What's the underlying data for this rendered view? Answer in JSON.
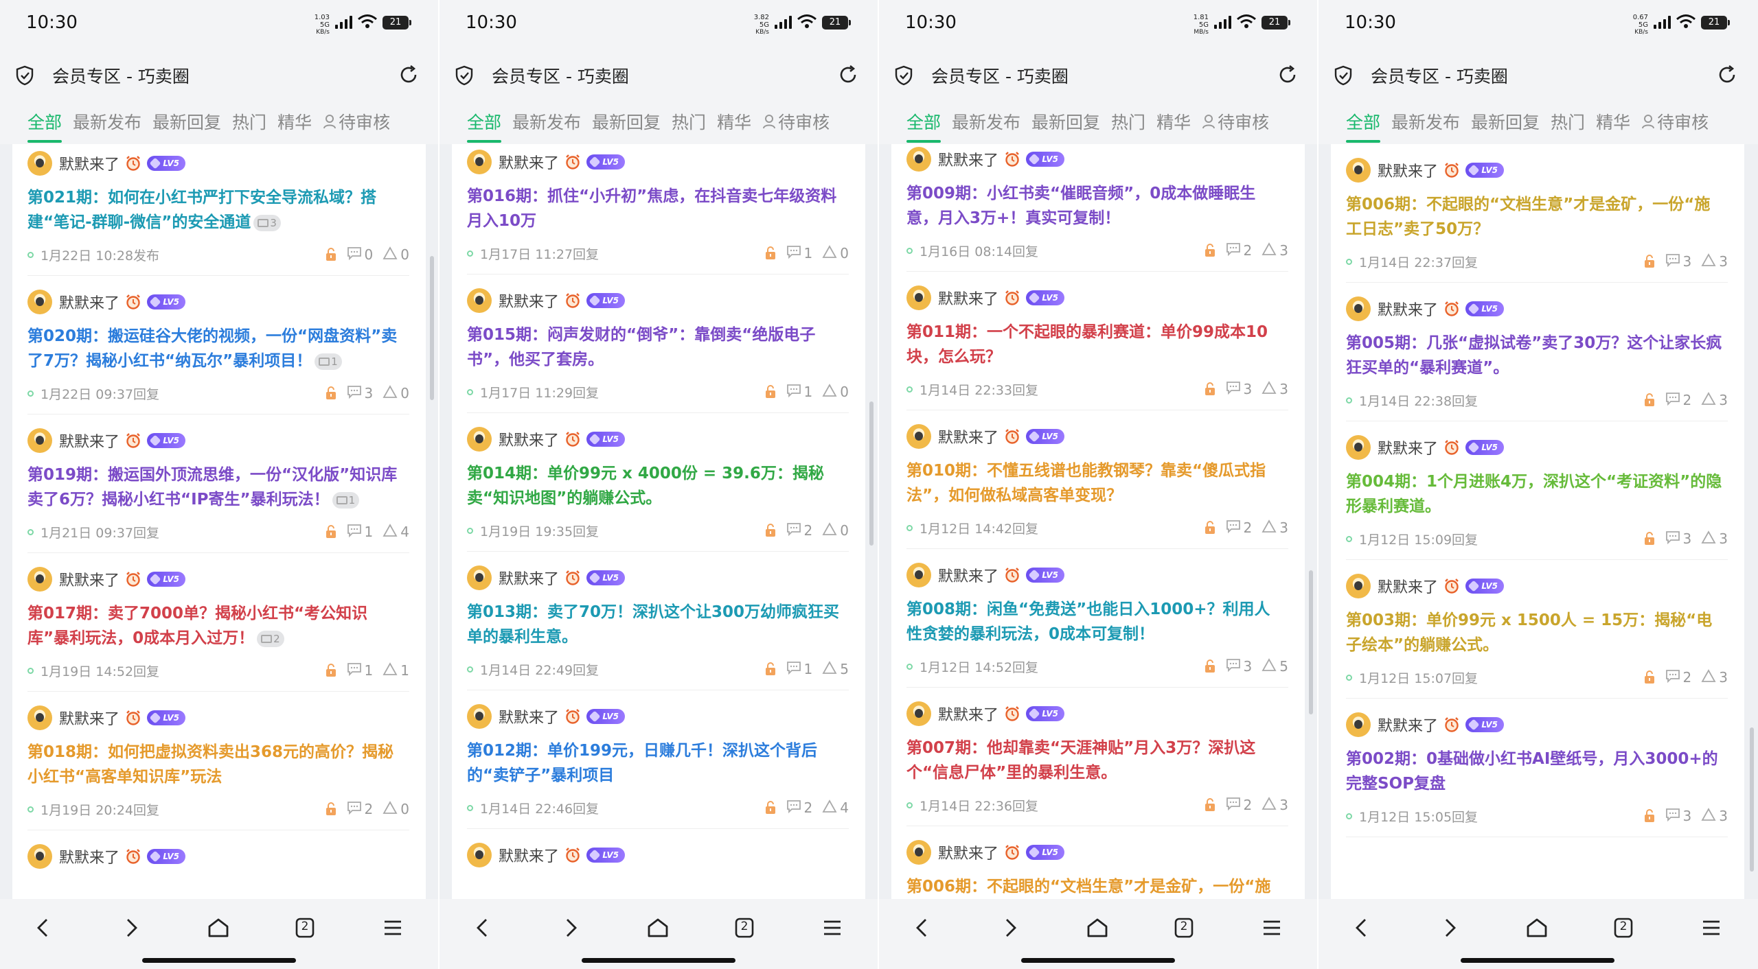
{
  "status": {
    "time": "10:30",
    "battery": "21"
  },
  "page_title": "会员专区 - 巧卖圈",
  "tabs": [
    "全部",
    "最新发布",
    "最新回复",
    "热门",
    "精华",
    "待审核"
  ],
  "author": {
    "name": "默默来了",
    "level": "LV5"
  },
  "colors": {
    "accent": "#19b86c",
    "badge": "#7b5cf0"
  },
  "screens": [
    {
      "net": [
        "1.03 5G",
        "KB/s"
      ],
      "scroll_fraction": 0.18,
      "posts": [
        {
          "title": "第021期：如何在小红书严打下安全导流私域？搭建“笔记-群聊-微信”的安全通道",
          "color": "teal",
          "images": "3",
          "time": "1月22日 10:28发布",
          "comments": "0",
          "likes": "0"
        },
        {
          "title": "第020期：搬运硅谷大佬的视频，一份“网盘资料”卖了7万？揭秘小红书“纳瓦尔”暴利项目！",
          "color": "blue",
          "images": "1",
          "time": "1月22日 09:37回复",
          "comments": "3",
          "likes": "0"
        },
        {
          "title": "第019期：搬运国外顶流思维，一份“汉化版”知识库卖了6万？揭秘小红书“IP寄生”暴利玩法！",
          "color": "purple",
          "images": "1",
          "time": "1月21日 09:37回复",
          "comments": "1",
          "likes": "4"
        },
        {
          "title": "第017期：卖了7000单？揭秘小红书“考公知识库”暴利玩法，0成本月入过万！",
          "color": "red",
          "images": "2",
          "time": "1月19日 14:52回复",
          "comments": "1",
          "likes": "1"
        },
        {
          "title": "第018期：如何把虚拟资料卖出368元的高价？揭秘小红书“高客单知识库”玩法",
          "color": "orange",
          "images": "",
          "time": "1月19日 20:24回复",
          "comments": "2",
          "likes": "0"
        },
        {
          "title": "",
          "color": "teal",
          "images": "",
          "time": "",
          "comments": "",
          "likes": ""
        }
      ]
    },
    {
      "net": [
        "3.82 5G",
        "KB/s"
      ],
      "scroll_fraction": 0.42,
      "posts": [
        {
          "title": "第016期：抓住“小升初”焦虑，在抖音卖七年级资料月入10万",
          "color": "purple",
          "images": "",
          "time": "1月17日 11:27回复",
          "comments": "1",
          "likes": "0"
        },
        {
          "title": "第015期：闷声发财的“倒爷”：靠倒卖“绝版电子书”，他买了套房。",
          "color": "purple",
          "images": "",
          "time": "1月17日 11:29回复",
          "comments": "1",
          "likes": "0"
        },
        {
          "title": "第014期：单价99元 x 4000份 = 39.6万：揭秘卖“知识地图”的躺赚公式。",
          "color": "green",
          "images": "",
          "time": "1月19日 19:35回复",
          "comments": "2",
          "likes": "0"
        },
        {
          "title": "第013期：卖了70万！深扒这个让300万幼师疯狂买单的暴利生意。",
          "color": "teal",
          "images": "",
          "time": "1月14日 22:49回复",
          "comments": "1",
          "likes": "5"
        },
        {
          "title": "第012期：单价199元，日赚几千！深扒这个背后的“卖铲子”暴利项目",
          "color": "blue",
          "images": "",
          "time": "1月14日 22:46回复",
          "comments": "2",
          "likes": "4"
        },
        {
          "title": "",
          "color": "purple",
          "images": "",
          "time": "",
          "comments": "",
          "likes": ""
        }
      ]
    },
    {
      "net": [
        "1.81 5G",
        "MB/s"
      ],
      "scroll_fraction": 0.7,
      "posts": [
        {
          "title": "第009期：小红书卖“催眠音频”，0成本做睡眠生意，月入3万+！真实可复制！",
          "color": "purple",
          "images": "",
          "time": "1月16日 08:14回复",
          "comments": "2",
          "likes": "3"
        },
        {
          "title": "第011期：一个不起眼的暴利赛道：单价99成本10块，怎么玩？",
          "color": "red",
          "images": "",
          "time": "1月14日 22:33回复",
          "comments": "3",
          "likes": "3"
        },
        {
          "title": "第010期：不懂五线谱也能教钢琴？靠卖“傻瓜式指法”，如何做私域高客单变现？",
          "color": "orange",
          "images": "",
          "time": "1月12日 14:42回复",
          "comments": "2",
          "likes": "3"
        },
        {
          "title": "第008期：闲鱼“免费送”也能日入1000+？利用人性贪婪的暴利玩法，0成本可复制！",
          "color": "teal",
          "images": "",
          "time": "1月12日 14:52回复",
          "comments": "3",
          "likes": "5"
        },
        {
          "title": "第007期：他却靠卖“天涯神贴”月入3万？深扒这个“信息尸体”里的暴利生意。",
          "color": "red",
          "images": "",
          "time": "1月14日 22:36回复",
          "comments": "2",
          "likes": "3"
        },
        {
          "title": "第006期：不起眼的“文档生意”才是金矿，一份“施",
          "color": "orange",
          "images": "",
          "time": "",
          "comments": "",
          "likes": ""
        }
      ]
    },
    {
      "net": [
        "0.67 5G",
        "KB/s"
      ],
      "scroll_fraction": 0.96,
      "posts": [
        {
          "title": "第006期：不起眼的“文档生意”才是金矿，一份“施工日志”卖了50万？",
          "color": "gold",
          "images": "",
          "time": "1月14日 22:37回复",
          "comments": "3",
          "likes": "3"
        },
        {
          "title": "第005期：几张“虚拟试卷”卖了30万？这个让家长疯狂买单的“暴利赛道”。",
          "color": "purple",
          "images": "",
          "time": "1月14日 22:38回复",
          "comments": "2",
          "likes": "3"
        },
        {
          "title": "第004期：1个月进账4万，深扒这个“考证资料”的隐形暴利赛道。",
          "color": "lime",
          "images": "",
          "time": "1月12日 15:09回复",
          "comments": "3",
          "likes": "3"
        },
        {
          "title": "第003期：单价99元 x 1500人 = 15万：揭秘“电子绘本”的躺赚公式。",
          "color": "gold",
          "images": "",
          "time": "1月12日 15:07回复",
          "comments": "2",
          "likes": "3"
        },
        {
          "title": "第002期：0基础做小红书AI壁纸号，月入3000+的完整SOP复盘",
          "color": "purple",
          "images": "",
          "time": "1月12日 15:05回复",
          "comments": "3",
          "likes": "3"
        }
      ]
    }
  ],
  "bottom_nav": {
    "tab_count": "2"
  }
}
